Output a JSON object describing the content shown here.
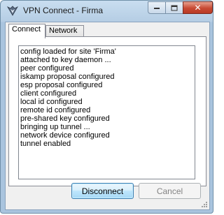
{
  "window": {
    "title": "VPN Connect - Firma",
    "icon": "shrew-soft-vpn-icon",
    "close_glyph": "✕",
    "accent": "#c84a33"
  },
  "tabs": [
    {
      "label": "Connect",
      "active": true
    },
    {
      "label": "Network",
      "active": false
    }
  ],
  "log": {
    "lines": [
      "config loaded for site 'Firma'",
      "attached to key daemon ...",
      "peer configured",
      "iskamp proposal configured",
      "esp proposal configured",
      "client configured",
      "local id configured",
      "remote id configured",
      "pre-shared key configured",
      "bringing up tunnel ...",
      "network device configured",
      "tunnel enabled"
    ]
  },
  "buttons": {
    "disconnect": "Disconnect",
    "cancel": "Cancel"
  }
}
